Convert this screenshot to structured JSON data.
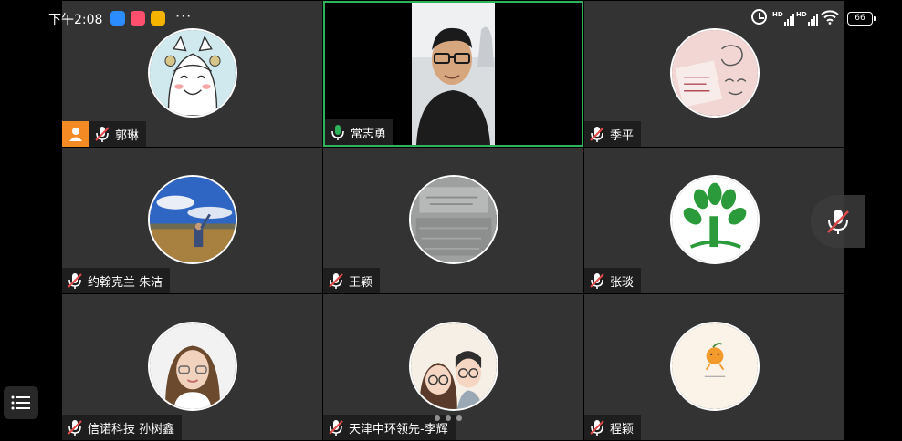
{
  "status_bar": {
    "time": "下午2:08",
    "more": "···",
    "battery": "66",
    "signal_label": "HD",
    "app_icon_colors": [
      "#2b8cff",
      "#ff4f6e",
      "#f5b400"
    ]
  },
  "participants": [
    {
      "name": "郭琳",
      "mic": "muted",
      "host": true,
      "avatar": "cartoon-girl"
    },
    {
      "name": "常志勇",
      "mic": "speaking",
      "host": false,
      "avatar": "video"
    },
    {
      "name": "季平",
      "mic": "muted",
      "host": false,
      "avatar": "sketch"
    },
    {
      "name": "约翰克兰 朱洁",
      "mic": "muted",
      "host": false,
      "avatar": "grassland"
    },
    {
      "name": "王颖",
      "mic": "muted",
      "host": false,
      "avatar": "stone"
    },
    {
      "name": "张琰",
      "mic": "muted",
      "host": false,
      "avatar": "tree-logo"
    },
    {
      "name": "信诺科技 孙树鑫",
      "mic": "muted",
      "host": false,
      "avatar": "portrait"
    },
    {
      "name": "天津中环领先-李辉",
      "mic": "muted",
      "host": false,
      "avatar": "couple-cartoon"
    },
    {
      "name": "程颖",
      "mic": "muted",
      "host": false,
      "avatar": "orange"
    }
  ],
  "colors": {
    "tile_bg": "#333333",
    "speaking_border": "#2fb25a",
    "host_badge": "#f38a24",
    "muted_mic": "#e24b4b"
  },
  "page_indicator": {
    "pages": 3,
    "current": 1
  }
}
